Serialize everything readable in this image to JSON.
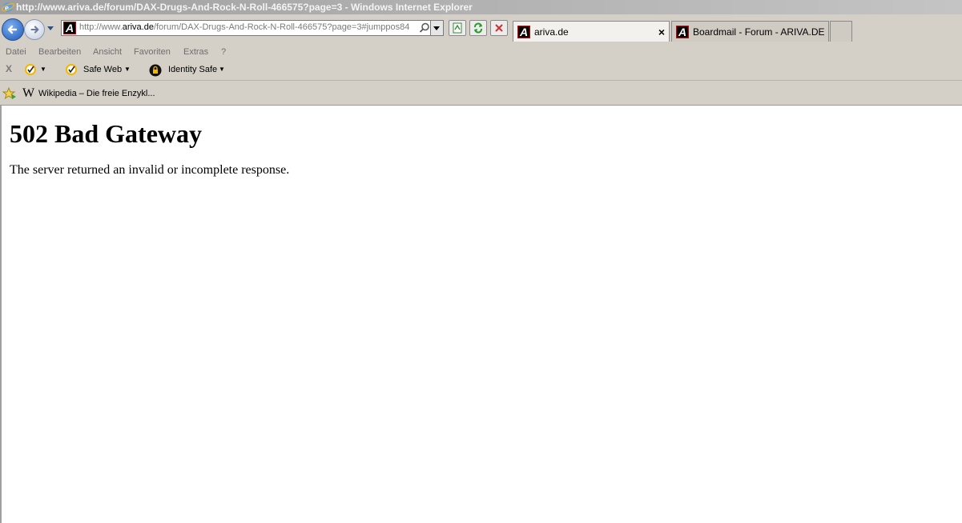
{
  "window": {
    "title": "http://www.ariva.de/forum/DAX-Drugs-And-Rock-N-Roll-466575?page=3 - Windows Internet Explorer"
  },
  "address_bar": {
    "url_prefix": "http://www.",
    "url_domain": "ariva.de",
    "url_path": "/forum/DAX-Drugs-And-Rock-N-Roll-466575?page=3#jumppos84"
  },
  "tabs": [
    {
      "label": "ariva.de",
      "active": true,
      "icon": "ariva-icon"
    },
    {
      "label": "Boardmail - Forum - ARIVA.DE",
      "active": false,
      "icon": "ariva-icon"
    }
  ],
  "menu": [
    "Datei",
    "Bearbeiten",
    "Ansicht",
    "Favoriten",
    "Extras",
    "?"
  ],
  "norton_toolbar": {
    "close": "X",
    "safe_web": "Safe Web",
    "identity_safe": "Identity Safe"
  },
  "favorites": {
    "item": "Wikipedia – Die freie Enzykl...",
    "wiki_letter": "W"
  },
  "page": {
    "heading": "502 Bad Gateway",
    "message": "The server returned an invalid or incomplete response."
  },
  "colors": {
    "chrome": "#d4d0c8",
    "ariva_red": "#cc0000",
    "norton_yellow": "#f3b700"
  }
}
